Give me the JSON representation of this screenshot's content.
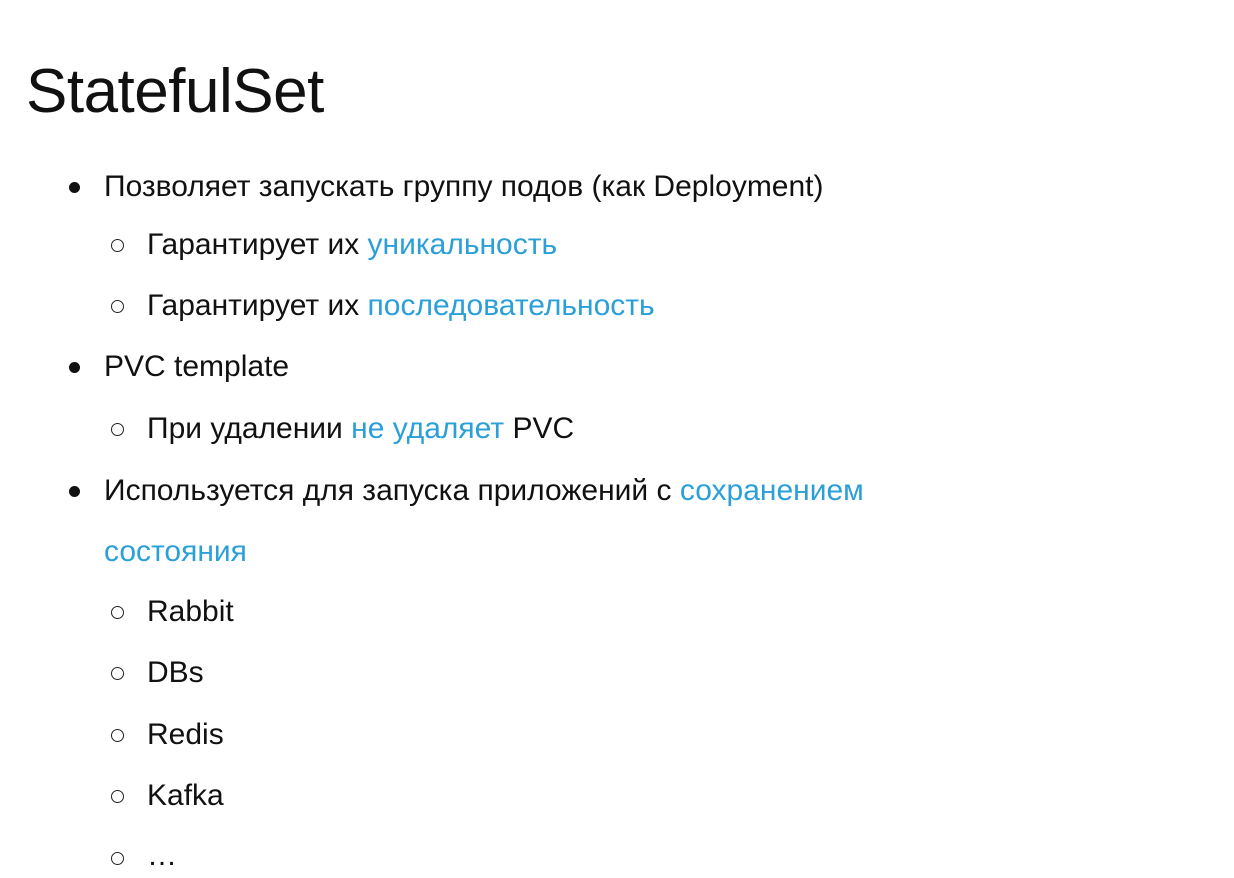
{
  "slide": {
    "title": "StatefulSet",
    "items": [
      {
        "text": "Позволяет запускать группу подов (как Deployment)",
        "sub": [
          {
            "text": "Гарантирует их ",
            "highlight": "уникальность"
          },
          {
            "text": "Гарантирует их ",
            "highlight": "последовательность"
          }
        ]
      },
      {
        "text": "PVC template",
        "sub": [
          {
            "text": "При удалении ",
            "highlight": "не удаляет",
            "suffix": " PVC"
          }
        ]
      },
      {
        "text": "Используется для запуска приложений с ",
        "highlight": "сохранением",
        "continuation": "состояния",
        "sub": [
          {
            "text": "Rabbit"
          },
          {
            "text": "DBs"
          },
          {
            "text": "Redis"
          },
          {
            "text": "Kafka"
          },
          {
            "text": "…"
          }
        ]
      }
    ]
  },
  "colors": {
    "text": "#111111",
    "highlight": "#2a9fd8",
    "background": "#ffffff"
  }
}
